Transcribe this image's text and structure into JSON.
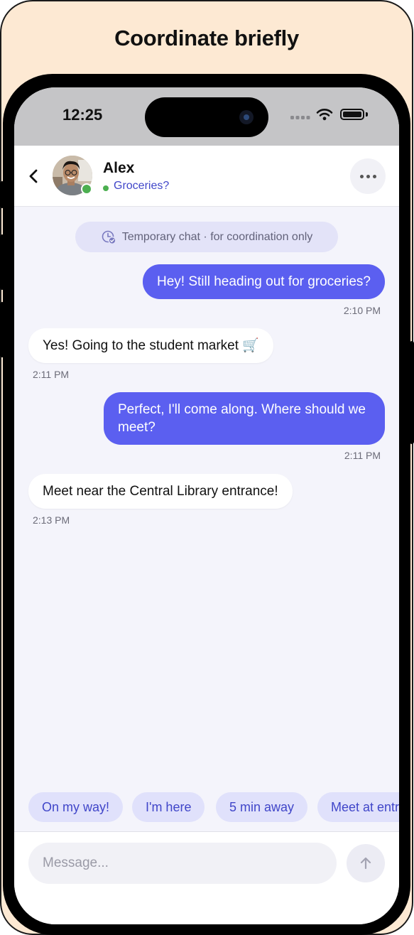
{
  "page": {
    "title": "Coordinate briefly"
  },
  "status_bar": {
    "time": "12:25"
  },
  "header": {
    "contact_name": "Alex",
    "contact_status": "Groceries?",
    "online": true,
    "icons": [
      "back-chevron-icon",
      "avatar",
      "more-icon"
    ]
  },
  "notice": {
    "text": "Temporary chat · for coordination only",
    "icon": "clock-check-icon"
  },
  "messages": [
    {
      "direction": "outgoing",
      "text": "Hey! Still heading out for groceries?",
      "time": "2:10 PM"
    },
    {
      "direction": "incoming",
      "text": "Yes! Going to the student market 🛒",
      "time": "2:11 PM"
    },
    {
      "direction": "outgoing",
      "text": "Perfect, I'll come along. Where should we meet?",
      "time": "2:11 PM"
    },
    {
      "direction": "incoming",
      "text": "Meet near the Central Library entrance!",
      "time": "2:13 PM"
    }
  ],
  "quick_replies": [
    "On my way!",
    "I'm here",
    "5 min away",
    "Meet at entrance"
  ],
  "composer": {
    "placeholder": "Message...",
    "send_icon": "arrow-up-icon"
  },
  "colors": {
    "accent": "#5b5ff0",
    "chip_bg": "#e0e1fb",
    "chip_text": "#4046c9",
    "page_bg": "#fde9d3",
    "chat_bg": "#f4f4fb",
    "online": "#4caf50"
  }
}
